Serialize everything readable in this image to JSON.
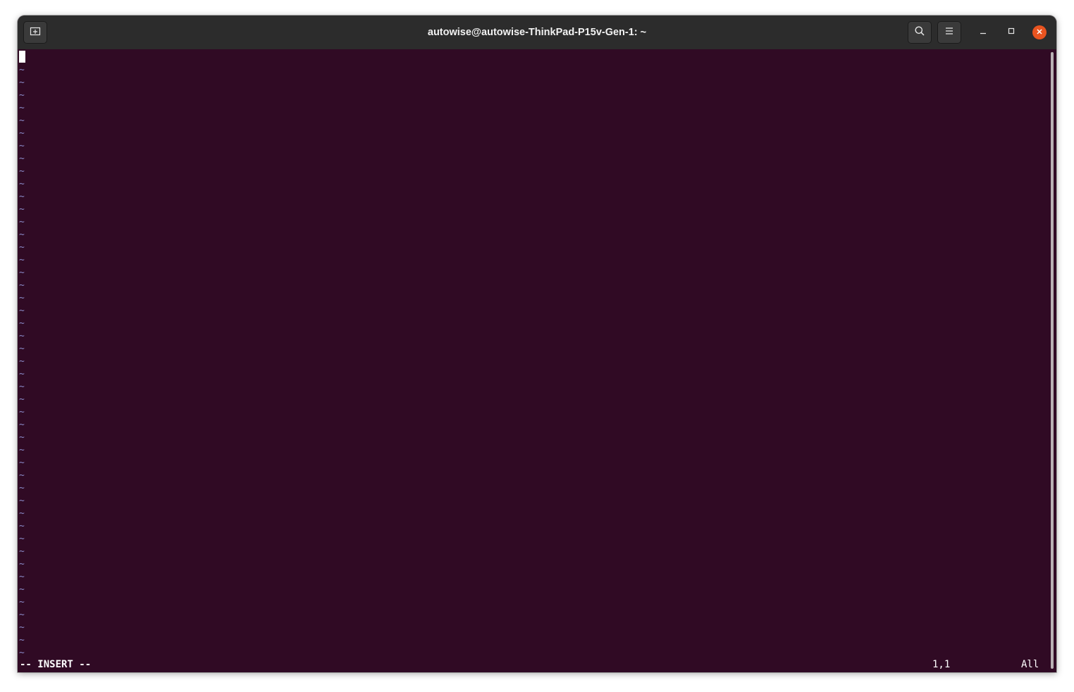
{
  "window": {
    "title": "autowise@autowise-ThinkPad-P15v-Gen-1: ~"
  },
  "header_buttons": {
    "new_tab_icon": "new-tab-icon",
    "search_icon": "search-icon",
    "menu_icon": "hamburger-menu-icon",
    "minimize_icon": "minimize-icon",
    "maximize_icon": "maximize-icon",
    "close_icon": "close-icon"
  },
  "editor": {
    "empty_line_marker": "~",
    "empty_line_count": 47,
    "mode": "-- INSERT --",
    "cursor_position": "1,1",
    "scroll_position": "All"
  },
  "colors": {
    "terminal_background": "#300a24",
    "titlebar_background": "#2c2c2c",
    "tilde_color": "#8a8ac8",
    "close_button": "#e95420"
  }
}
